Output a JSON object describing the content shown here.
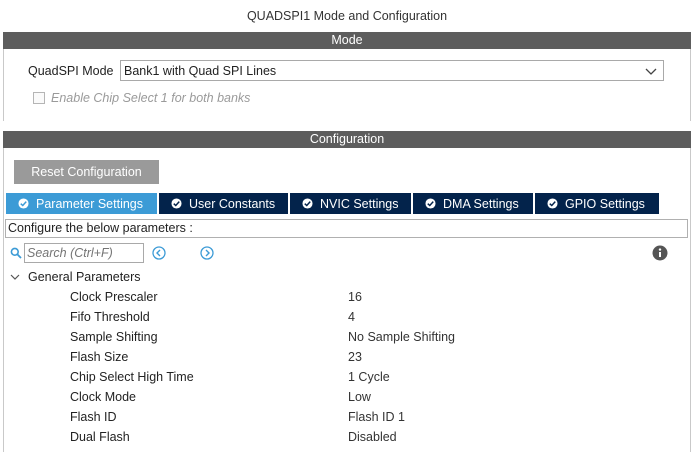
{
  "window": {
    "title": "QUADSPI1 Mode and Configuration"
  },
  "mode_section": {
    "header": "Mode",
    "quadspi_mode_label": "QuadSPI Mode",
    "quadspi_mode_value": "Bank1 with Quad SPI Lines",
    "chip_select_label": "Enable Chip Select 1 for both banks",
    "chip_select_checked": false
  },
  "config_section": {
    "header": "Configuration",
    "reset_label": "Reset Configuration",
    "tabs": [
      {
        "label": "Parameter Settings",
        "active": true
      },
      {
        "label": "User Constants",
        "active": false
      },
      {
        "label": "NVIC Settings",
        "active": false
      },
      {
        "label": "DMA Settings",
        "active": false
      },
      {
        "label": "GPIO Settings",
        "active": false
      }
    ],
    "hint": "Configure the below parameters :",
    "search_placeholder": "Search (Ctrl+F)",
    "group_label": "General Parameters",
    "params": [
      {
        "name": "Clock Prescaler",
        "value": "16"
      },
      {
        "name": "Fifo Threshold",
        "value": "4"
      },
      {
        "name": "Sample Shifting",
        "value": "No Sample Shifting"
      },
      {
        "name": "Flash Size",
        "value": "23"
      },
      {
        "name": "Chip Select High Time",
        "value": "1 Cycle"
      },
      {
        "name": "Clock Mode",
        "value": "Low"
      },
      {
        "name": "Flash ID",
        "value": "Flash ID 1"
      },
      {
        "name": "Dual Flash",
        "value": "Disabled"
      }
    ]
  },
  "colors": {
    "section_header_bg": "#5d5d5d",
    "tab_bg": "#03234b",
    "tab_active_bg": "#3c9bd6",
    "reset_button_bg": "#9a9a9a",
    "accent_icon": "#3c9bd6"
  },
  "icons": {
    "dropdown": "chevron-down-icon",
    "tab_check": "check-circle-icon",
    "search": "search-icon",
    "prev": "arrow-left-circle-icon",
    "next": "arrow-right-circle-icon",
    "info": "info-icon",
    "tree_toggle": "caret-down-icon"
  }
}
